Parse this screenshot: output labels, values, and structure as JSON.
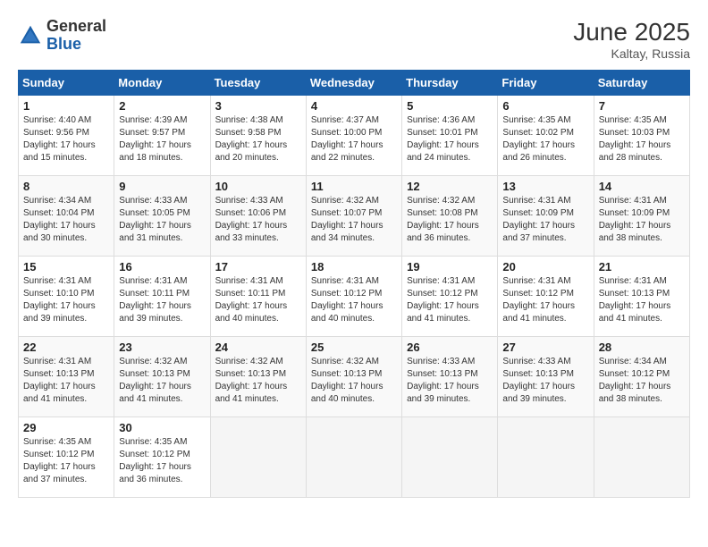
{
  "logo": {
    "general": "General",
    "blue": "Blue"
  },
  "title": "June 2025",
  "location": "Kaltay, Russia",
  "days_of_week": [
    "Sunday",
    "Monday",
    "Tuesday",
    "Wednesday",
    "Thursday",
    "Friday",
    "Saturday"
  ],
  "weeks": [
    [
      {
        "day": 1,
        "sunrise": "4:40 AM",
        "sunset": "9:56 PM",
        "daylight": "17 hours and 15 minutes."
      },
      {
        "day": 2,
        "sunrise": "4:39 AM",
        "sunset": "9:57 PM",
        "daylight": "17 hours and 18 minutes."
      },
      {
        "day": 3,
        "sunrise": "4:38 AM",
        "sunset": "9:58 PM",
        "daylight": "17 hours and 20 minutes."
      },
      {
        "day": 4,
        "sunrise": "4:37 AM",
        "sunset": "10:00 PM",
        "daylight": "17 hours and 22 minutes."
      },
      {
        "day": 5,
        "sunrise": "4:36 AM",
        "sunset": "10:01 PM",
        "daylight": "17 hours and 24 minutes."
      },
      {
        "day": 6,
        "sunrise": "4:35 AM",
        "sunset": "10:02 PM",
        "daylight": "17 hours and 26 minutes."
      },
      {
        "day": 7,
        "sunrise": "4:35 AM",
        "sunset": "10:03 PM",
        "daylight": "17 hours and 28 minutes."
      }
    ],
    [
      {
        "day": 8,
        "sunrise": "4:34 AM",
        "sunset": "10:04 PM",
        "daylight": "17 hours and 30 minutes."
      },
      {
        "day": 9,
        "sunrise": "4:33 AM",
        "sunset": "10:05 PM",
        "daylight": "17 hours and 31 minutes."
      },
      {
        "day": 10,
        "sunrise": "4:33 AM",
        "sunset": "10:06 PM",
        "daylight": "17 hours and 33 minutes."
      },
      {
        "day": 11,
        "sunrise": "4:32 AM",
        "sunset": "10:07 PM",
        "daylight": "17 hours and 34 minutes."
      },
      {
        "day": 12,
        "sunrise": "4:32 AM",
        "sunset": "10:08 PM",
        "daylight": "17 hours and 36 minutes."
      },
      {
        "day": 13,
        "sunrise": "4:31 AM",
        "sunset": "10:09 PM",
        "daylight": "17 hours and 37 minutes."
      },
      {
        "day": 14,
        "sunrise": "4:31 AM",
        "sunset": "10:09 PM",
        "daylight": "17 hours and 38 minutes."
      }
    ],
    [
      {
        "day": 15,
        "sunrise": "4:31 AM",
        "sunset": "10:10 PM",
        "daylight": "17 hours and 39 minutes."
      },
      {
        "day": 16,
        "sunrise": "4:31 AM",
        "sunset": "10:11 PM",
        "daylight": "17 hours and 39 minutes."
      },
      {
        "day": 17,
        "sunrise": "4:31 AM",
        "sunset": "10:11 PM",
        "daylight": "17 hours and 40 minutes."
      },
      {
        "day": 18,
        "sunrise": "4:31 AM",
        "sunset": "10:12 PM",
        "daylight": "17 hours and 40 minutes."
      },
      {
        "day": 19,
        "sunrise": "4:31 AM",
        "sunset": "10:12 PM",
        "daylight": "17 hours and 41 minutes."
      },
      {
        "day": 20,
        "sunrise": "4:31 AM",
        "sunset": "10:12 PM",
        "daylight": "17 hours and 41 minutes."
      },
      {
        "day": 21,
        "sunrise": "4:31 AM",
        "sunset": "10:13 PM",
        "daylight": "17 hours and 41 minutes."
      }
    ],
    [
      {
        "day": 22,
        "sunrise": "4:31 AM",
        "sunset": "10:13 PM",
        "daylight": "17 hours and 41 minutes."
      },
      {
        "day": 23,
        "sunrise": "4:32 AM",
        "sunset": "10:13 PM",
        "daylight": "17 hours and 41 minutes."
      },
      {
        "day": 24,
        "sunrise": "4:32 AM",
        "sunset": "10:13 PM",
        "daylight": "17 hours and 41 minutes."
      },
      {
        "day": 25,
        "sunrise": "4:32 AM",
        "sunset": "10:13 PM",
        "daylight": "17 hours and 40 minutes."
      },
      {
        "day": 26,
        "sunrise": "4:33 AM",
        "sunset": "10:13 PM",
        "daylight": "17 hours and 39 minutes."
      },
      {
        "day": 27,
        "sunrise": "4:33 AM",
        "sunset": "10:13 PM",
        "daylight": "17 hours and 39 minutes."
      },
      {
        "day": 28,
        "sunrise": "4:34 AM",
        "sunset": "10:12 PM",
        "daylight": "17 hours and 38 minutes."
      }
    ],
    [
      {
        "day": 29,
        "sunrise": "4:35 AM",
        "sunset": "10:12 PM",
        "daylight": "17 hours and 37 minutes."
      },
      {
        "day": 30,
        "sunrise": "4:35 AM",
        "sunset": "10:12 PM",
        "daylight": "17 hours and 36 minutes."
      },
      null,
      null,
      null,
      null,
      null
    ]
  ]
}
